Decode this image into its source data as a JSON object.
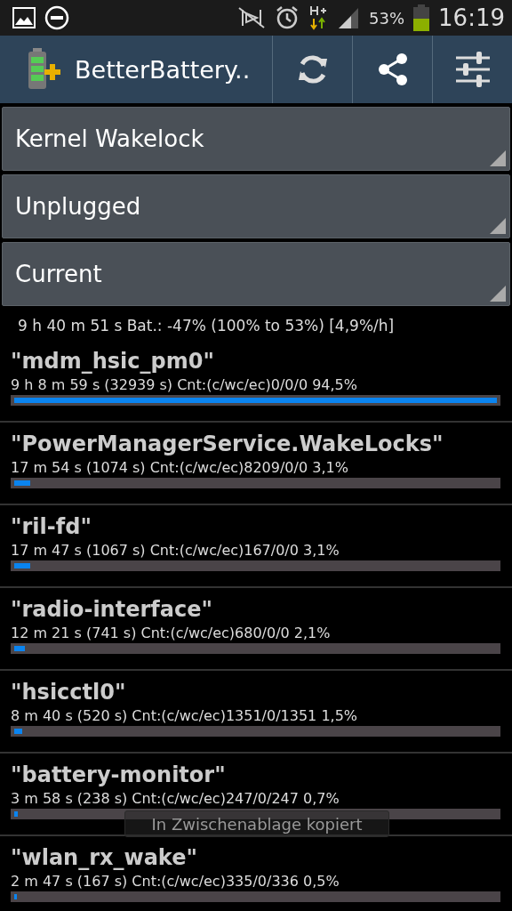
{
  "status_bar": {
    "battery_percent": "53%",
    "time": "16:19"
  },
  "action_bar": {
    "title": "BetterBattery.."
  },
  "spinners": [
    {
      "value": "Kernel Wakelock"
    },
    {
      "value": "Unplugged"
    },
    {
      "value": "Current"
    }
  ],
  "summary": "9 h 40 m 51 s  Bat.: -47% (100% to 53%) [4,9%/h]",
  "wakelocks": [
    {
      "name": "\"mdm_hsic_pm0\"",
      "detail": "9 h 8 m 59 s  (32939 s) Cnt:(c/wc/ec)0/0/0 94,5%",
      "level": 1
    },
    {
      "name": "\"PowerManagerService.WakeLocks\"",
      "detail": "17 m 54 s  (1074 s) Cnt:(c/wc/ec)8209/0/0 3,1%",
      "level": 0.033
    },
    {
      "name": "\"ril-fd\"",
      "detail": "17 m 47 s  (1067 s) Cnt:(c/wc/ec)167/0/0 3,1%",
      "level": 0.033
    },
    {
      "name": "\"radio-interface\"",
      "detail": "12 m 21 s  (741 s) Cnt:(c/wc/ec)680/0/0 2,1%",
      "level": 0.022
    },
    {
      "name": "\"hsicctl0\"",
      "detail": "8 m 40 s  (520 s) Cnt:(c/wc/ec)1351/0/1351 1,5%",
      "level": 0.016
    },
    {
      "name": "\"battery-monitor\"",
      "detail": "3 m 58 s  (238 s) Cnt:(c/wc/ec)247/0/247 0,7%",
      "level": 0.007
    },
    {
      "name": "\"wlan_rx_wake\"",
      "detail": "2 m 47 s  (167 s) Cnt:(c/wc/ec)335/0/336 0,5%",
      "level": 0.005
    }
  ],
  "toast": {
    "text": "In Zwischenablage kopiert"
  }
}
